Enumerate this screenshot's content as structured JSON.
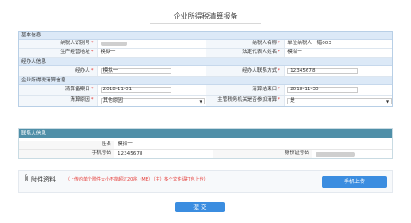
{
  "title": "企业所得税清算报备",
  "sections": {
    "basic": "基本信息",
    "agent": "经办人信息",
    "clearing": "企业所得税清算信息",
    "contact": "联系人信息"
  },
  "basic": {
    "tax_id_label": "纳税人识别号",
    "taxpayer_name_label": "纳税人名称",
    "taxpayer_name_value": "单位纳税人一错003",
    "address_label": "生产经营地址",
    "address_value": "模拟一",
    "legal_label": "法定代表人姓名",
    "legal_value": "模拟一"
  },
  "agent": {
    "name_label": "经办人",
    "name_value": "模拟一",
    "contact_label": "经办人联系方式",
    "contact_value": "12345678"
  },
  "clearing": {
    "start_label": "清算备案日",
    "start_value": "2018-11-01",
    "end_label": "清算结束日",
    "end_value": "2018-11-30",
    "reason_label": "清算原因",
    "reason_value": "其他原因",
    "cancel_label": "主管税务机关是否参加清算",
    "cancel_value": "是"
  },
  "contact": {
    "name_label": "姓名",
    "name_value": "模拟一",
    "phone_label": "手机号码",
    "phone_value": "12345678",
    "id_label": "身份证号码"
  },
  "attach": {
    "title": "附件资料",
    "note": "（上传的单个附件大小不能超过20兆（MB）（注）多个文件请打包上传）",
    "upload_label": "手机上传"
  },
  "submit_label": "提 交",
  "required_mark": "*",
  "caret": "▼"
}
